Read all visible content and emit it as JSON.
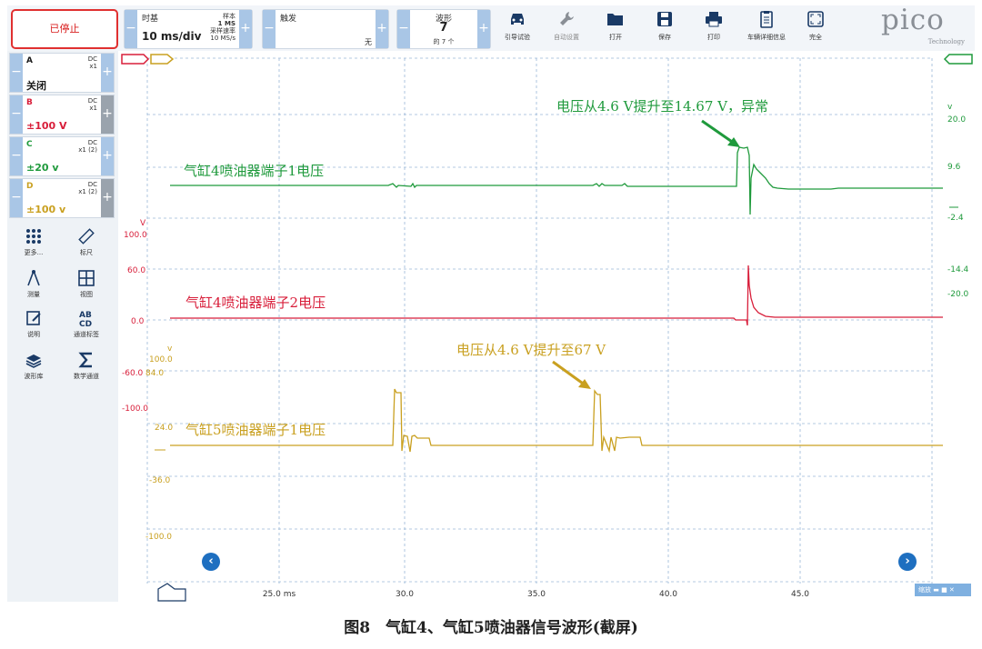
{
  "toolbar": {
    "stop_label": "已停止",
    "timebase": {
      "label": "时基",
      "value": "10 ms/div",
      "samples_label": "样本",
      "samples": "1 MS",
      "rate_label": "采样速率",
      "rate": "10 MS/s"
    },
    "trigger": {
      "label": "触发",
      "mode": "无"
    },
    "waveforms": {
      "label": "波形",
      "value": "7",
      "total": "的 7 个"
    },
    "tools": [
      {
        "label": "引导试验",
        "icon": "car-icon"
      },
      {
        "label": "自动设置",
        "icon": "wrench-icon"
      },
      {
        "label": "打开",
        "icon": "folder-icon"
      },
      {
        "label": "保存",
        "icon": "save-icon"
      },
      {
        "label": "打印",
        "icon": "printer-icon"
      },
      {
        "label": "车辆详细信息",
        "icon": "clipboard-icon"
      },
      {
        "label": "完全",
        "icon": "fullscreen-icon"
      }
    ],
    "logo": {
      "word": "pico",
      "sub": "Technology"
    }
  },
  "channels": [
    {
      "name": "A",
      "coupling": "DC",
      "probe": "x1",
      "range": "关闭",
      "color": "#1a1a1a"
    },
    {
      "name": "B",
      "coupling": "DC",
      "probe": "x1",
      "range": "±100 V",
      "color": "#d81e3a"
    },
    {
      "name": "C",
      "coupling": "DC",
      "probe": "x1 (2)",
      "range": "±20 v",
      "color": "#1f9a3c"
    },
    {
      "name": "D",
      "coupling": "DC",
      "probe": "x1 (2)",
      "range": "±100 v",
      "color": "#c9a020"
    }
  ],
  "left_tools": [
    {
      "label": "更多...",
      "icon": "grid-dots-icon"
    },
    {
      "label": "标尺",
      "icon": "ruler-icon"
    },
    {
      "label": "测量",
      "icon": "compass-icon"
    },
    {
      "label": "视图",
      "icon": "view-grid-icon"
    },
    {
      "label": "说明",
      "icon": "note-icon"
    },
    {
      "label": "通道标签",
      "icon": "abcd-icon"
    },
    {
      "label": "波形库",
      "icon": "library-icon"
    },
    {
      "label": "数学通道",
      "icon": "sigma-icon"
    }
  ],
  "scope": {
    "colors": {
      "green": "#1f9a3c",
      "red": "#d81e3a",
      "gold": "#c9a020",
      "grid": "#9ab8d8"
    },
    "x_ticks": [
      "25.0 ms",
      "30.0",
      "35.0",
      "40.0",
      "45.0"
    ],
    "right_axis_green": [
      "v",
      "20.0",
      "9.6",
      "-2.4",
      "-14.4",
      "-20.0"
    ],
    "left_axis_red": [
      "V",
      "100.0",
      "60.0",
      "0.0"
    ],
    "left_axis_gold": [
      "v",
      "100.0",
      "84.0",
      "-60.0",
      "-100.0",
      "24.0",
      "-36.0",
      "-100.0"
    ],
    "annotations": {
      "green_label": "气缸4喷油器端子1电压",
      "green_note": "电压从4.6 V提升至14.67 V，异常",
      "red_label": "气缸4喷油器端子2电压",
      "gold_label": "气缸5喷油器端子1电压",
      "gold_note": "电压从4.6 V提升至67 V"
    },
    "zoom_label": "缩放"
  },
  "caption": "图8　气缸4、气缸5喷油器信号波形(截屏)"
}
